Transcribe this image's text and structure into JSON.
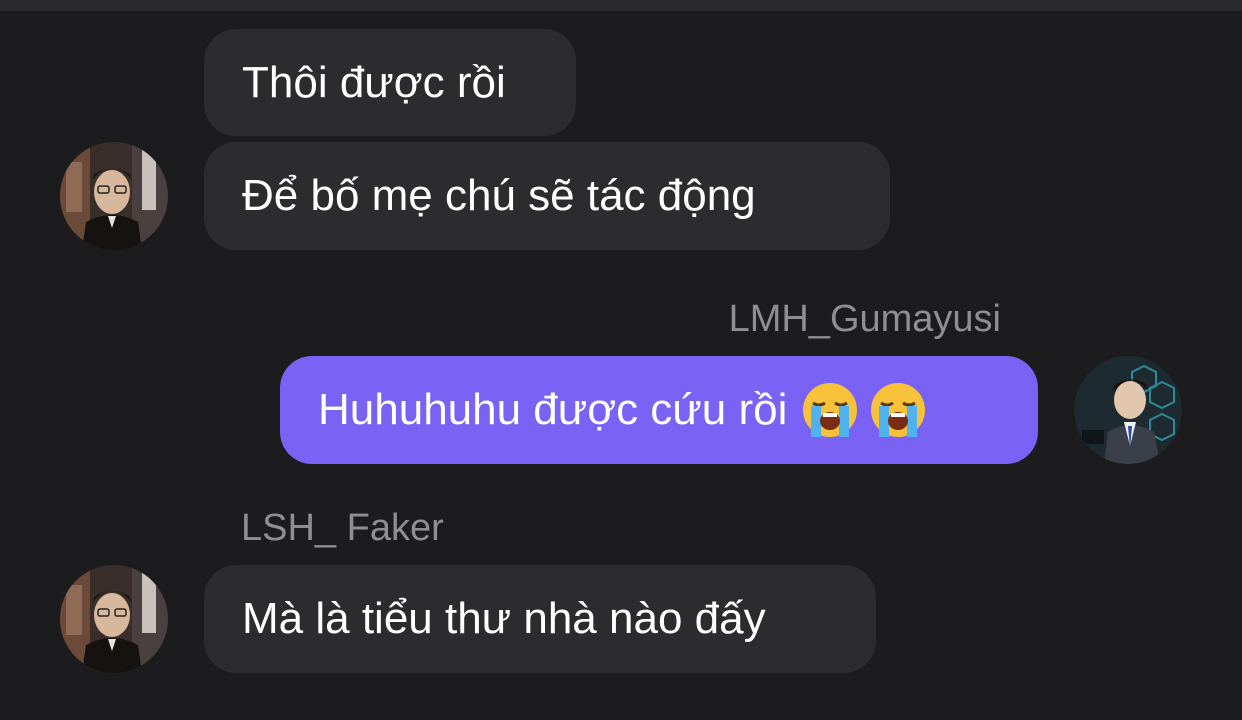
{
  "messages": [
    {
      "sender": "",
      "text": "Thôi được rồi",
      "mine": false
    },
    {
      "sender": "",
      "text": "Để bố mẹ chú sẽ tác động",
      "mine": false
    },
    {
      "sender": "LMH_Gumayusi",
      "text": "Huhuhuhu được cứu rồi",
      "emojis": [
        "loudly-crying-face-icon",
        "loudly-crying-face-icon"
      ],
      "mine": true
    },
    {
      "sender": "LSH_ Faker",
      "text": "Mà là tiểu thư nhà nào đấy",
      "mine": false
    }
  ],
  "colors": {
    "background": "#1c1c1e",
    "incoming_bubble": "#2c2c2e",
    "outgoing_bubble": "#7a62f5",
    "sender_name": "#8e8e93",
    "text": "#ffffff"
  }
}
